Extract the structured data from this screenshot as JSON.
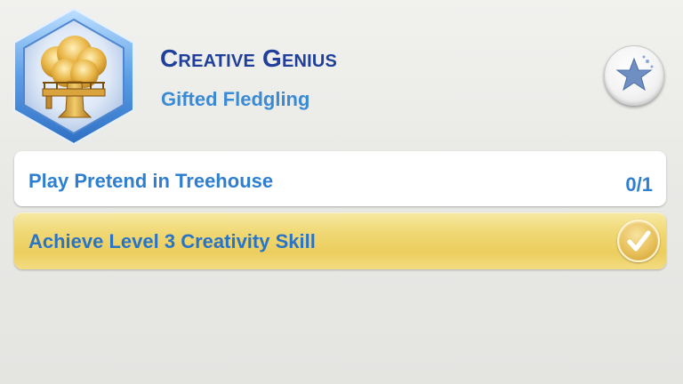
{
  "aspiration": {
    "title": "Creative Genius",
    "subtitle": "Gifted Fledgling",
    "badge_icon": "treehouse-hexagon-icon",
    "action_icon": "star-icon"
  },
  "milestones": [
    {
      "label": "Play Pretend in Treehouse",
      "progress": "0/1",
      "completed": false
    },
    {
      "label": "Achieve Level 3 Creativity Skill",
      "completed": true,
      "status_icon": "checkmark-icon"
    }
  ],
  "colors": {
    "title": "#1f3f9a",
    "text_accent": "#3b8bd4",
    "completed_row": "#f0d874",
    "badge_border": "#6fa5e0"
  }
}
